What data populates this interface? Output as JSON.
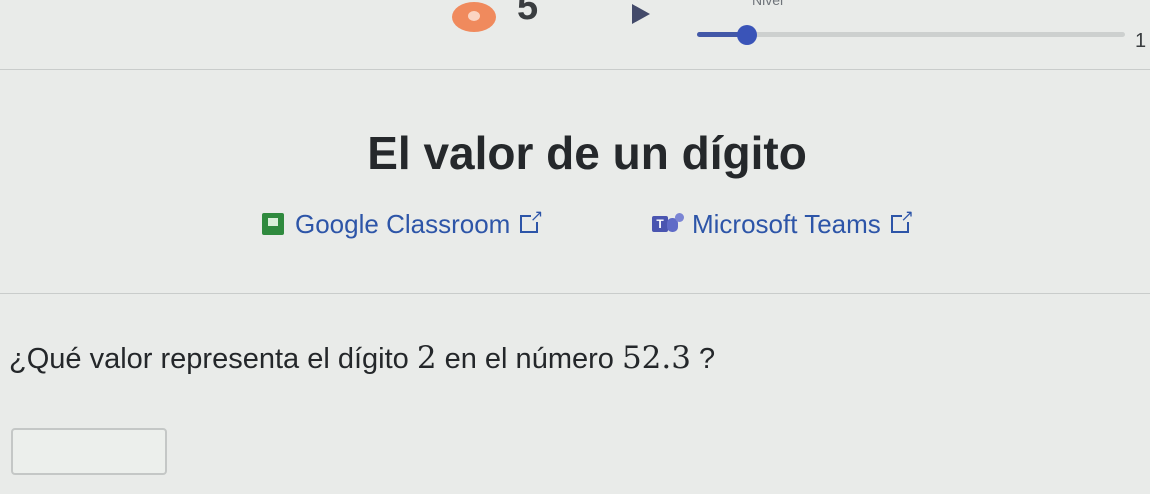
{
  "progress": {
    "streak_count": "5",
    "level_label": "Nivel",
    "level_max": "1",
    "level_fraction": 0.12
  },
  "page": {
    "title": "El valor de un dígito"
  },
  "share": {
    "google_label": "Google Classroom",
    "teams_label": "Microsoft Teams",
    "teams_glyph": "T"
  },
  "question": {
    "prefix": "¿Qué valor representa el dígito ",
    "digit": "2",
    "middle": " en el número ",
    "number": "52.3",
    "suffix": " ?"
  },
  "answer": {
    "value": ""
  },
  "colors": {
    "accent": "#3a54b8",
    "link": "#2d55a8",
    "streak": "#f08a5d"
  }
}
